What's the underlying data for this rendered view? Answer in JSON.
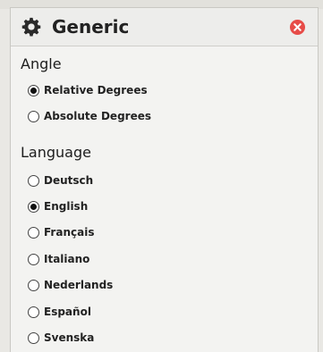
{
  "panel": {
    "title": "Generic",
    "icons": {
      "header": "gear-icon",
      "close": "close-icon"
    },
    "close_color": "#e74c48"
  },
  "sections": [
    {
      "label": "Angle",
      "options": [
        {
          "label": "Relative Degrees",
          "selected": true
        },
        {
          "label": "Absolute Degrees",
          "selected": false
        }
      ]
    },
    {
      "label": "Language",
      "options": [
        {
          "label": "Deutsch",
          "selected": false
        },
        {
          "label": "English",
          "selected": true
        },
        {
          "label": "Français",
          "selected": false
        },
        {
          "label": "Italiano",
          "selected": false
        },
        {
          "label": "Nederlands",
          "selected": false
        },
        {
          "label": "Español",
          "selected": false
        },
        {
          "label": "Svenska",
          "selected": false
        }
      ]
    }
  ]
}
